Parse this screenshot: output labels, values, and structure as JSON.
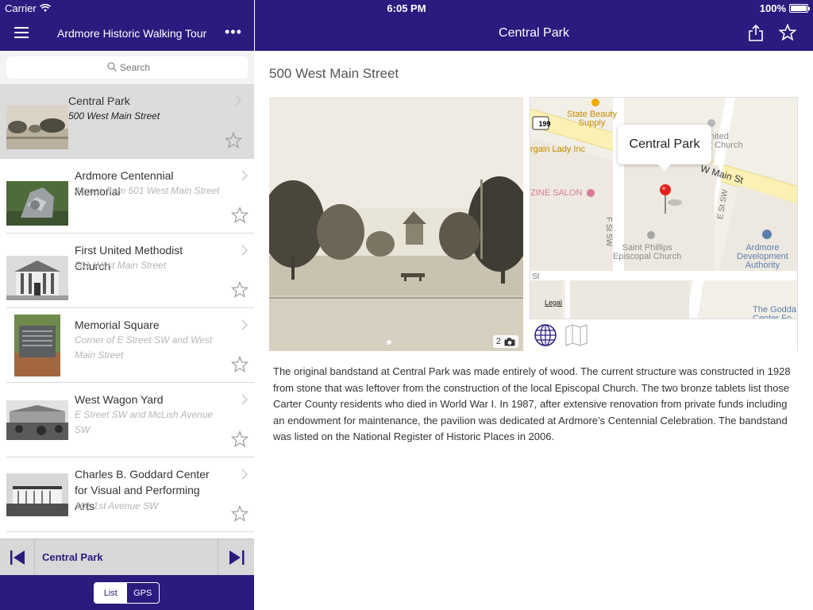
{
  "status": {
    "carrier": "Carrier",
    "time": "6:05 PM",
    "battery": "100%",
    "battery_level": 1.0
  },
  "sidebar": {
    "title": "Ardmore Historic Walking Tour",
    "more": "•••",
    "search_placeholder": "Search",
    "items": [
      {
        "title": "Central Park",
        "subtitle": "500 West Main Street",
        "selected": true
      },
      {
        "title": "Ardmore Centennial Memorial",
        "subtitle": "Across from 501 West Main Street"
      },
      {
        "title": "First United Methodist Church",
        "subtitle": "501 West Main Street"
      },
      {
        "title": "Memorial Square",
        "subtitle": "Corner of E Street SW and West Main Street"
      },
      {
        "title": "West Wagon Yard",
        "subtitle": "E Street SW and McLish Avenue SW"
      },
      {
        "title": "Charles B. Goddard Center for Visual and Performing Arts",
        "subtitle": "401 1st Avenue SW"
      }
    ],
    "now_playing": "Central Park",
    "segments": {
      "list": "List",
      "gps": "GPS"
    }
  },
  "detail": {
    "title": "Central Park",
    "address": "500 West Main Street",
    "photo_count": "2",
    "description": "The original bandstand at Central Park was made entirely of wood. The current structure was constructed in 1928 from stone that was leftover from the construction of the local Episcopal Church. The two bronze tablets list those Carter County residents who died in World War I. In 1987, after extensive renovation from private funds including an endowment for maintenance, the  pavilion was dedicated at Ardmore’s Centennial Celebration. The bandstand was listed on the National Register of Historic Places in 2006."
  },
  "map": {
    "callout": "Central Park",
    "labels": {
      "state_beauty": "State Beauty\nSupply",
      "bargain_lady": "rgain Lady Inc",
      "united_church": "nited\nt Church",
      "w_main": "W Main St",
      "zine_salon": "ZINE SALON",
      "f_st": "F St SW",
      "e_st": "E St SW",
      "saint_phillips": "Saint Phillips\nEpiscopal Church",
      "ardmore_dev": "Ardmore\nDevelopment\nAuthority",
      "st": "St",
      "goddard": "The Godda\nCenter Fo",
      "legal": "Legal",
      "route": "199"
    }
  },
  "colors": {
    "brand": "#2a1b7e",
    "pin": "#e3201b"
  }
}
